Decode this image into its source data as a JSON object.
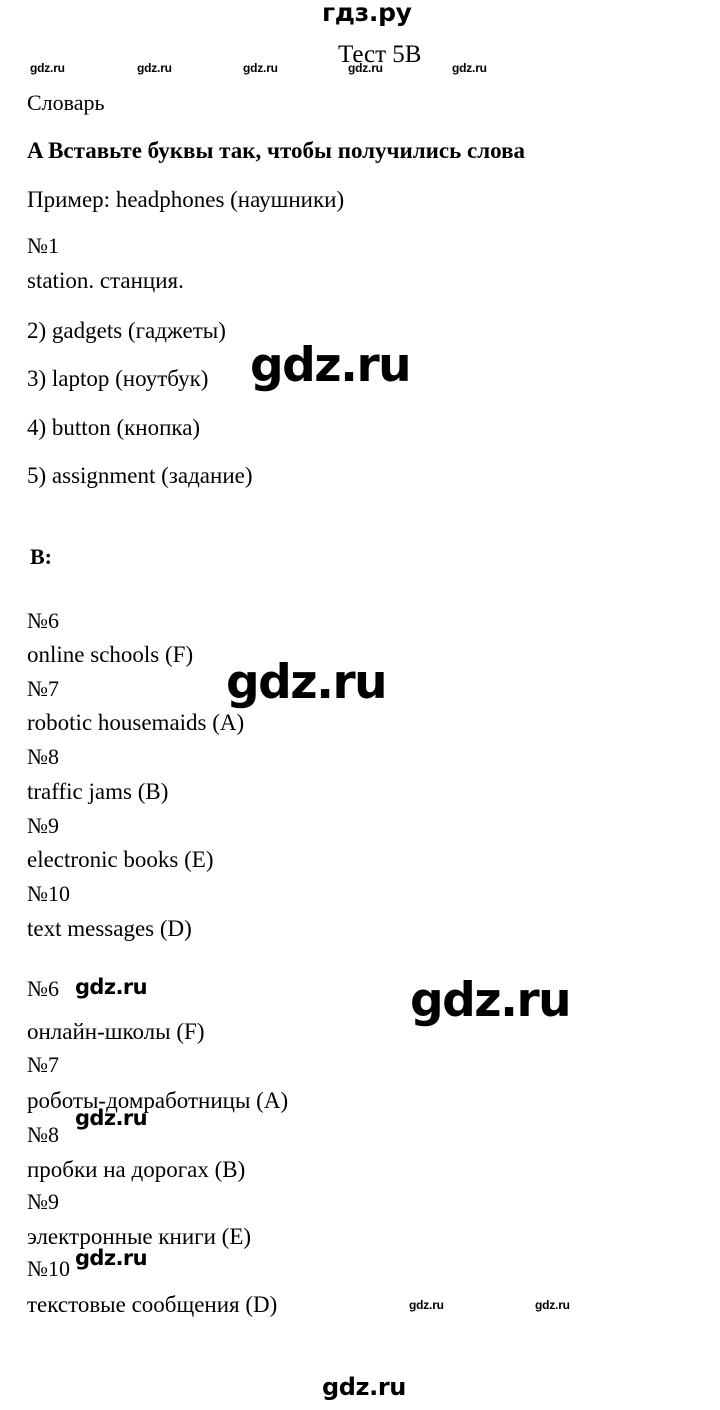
{
  "site": {
    "brand_top": "гдз.ру",
    "footer_brand": "gdz.ru",
    "watermark_text": "gdz.ru"
  },
  "header": {
    "test_title": "Тест 5B"
  },
  "document": {
    "section_label": "Словарь",
    "task_a_heading": "A Вставьте буквы так, чтобы получились слова",
    "example_line": "Пример: headphones (наушники)",
    "task_a_items": [
      {
        "number": "№1",
        "answer": "station. станция."
      },
      {
        "number": "2)",
        "answer": "2) gadgets (гаджеты)"
      },
      {
        "number": "3)",
        "answer": "3) laptop (ноутбук)"
      },
      {
        "number": "4)",
        "answer": "4) button (кнопка)"
      },
      {
        "number": "5)",
        "answer": "5) assignment (задание)"
      }
    ],
    "task_b_label": "B:",
    "task_b_english": [
      {
        "number": "№6",
        "answer": "online schools (F)"
      },
      {
        "number": "№7",
        "answer": "robotic housemaids (A)"
      },
      {
        "number": "№8",
        "answer": "traffic jams (B)"
      },
      {
        "number": "№9",
        "answer": "electronic books (E)"
      },
      {
        "number": "№10",
        "answer": "text messages (D)"
      }
    ],
    "task_b_russian": [
      {
        "number": "№6",
        "answer": "онлайн-школы (F)"
      },
      {
        "number": "№7",
        "answer": "роботы-домработницы (A)"
      },
      {
        "number": "№8",
        "answer": "пробки на дорогах (B)"
      },
      {
        "number": "№9",
        "answer": "электронные книги (E)"
      },
      {
        "number": "№10",
        "answer": "текстовые сообщения (D)"
      }
    ]
  },
  "watermarks": {
    "row_top": [
      "gdz.ru",
      "gdz.ru",
      "gdz.ru",
      "gdz.ru",
      "gdz.ru"
    ],
    "large": [
      "gdz.ru",
      "gdz.ru",
      "gdz.ru"
    ],
    "medium": [
      "gdz.ru",
      "gdz.ru",
      "gdz.ru"
    ],
    "bottom_row": [
      "gdz.ru",
      "gdz.ru"
    ]
  }
}
